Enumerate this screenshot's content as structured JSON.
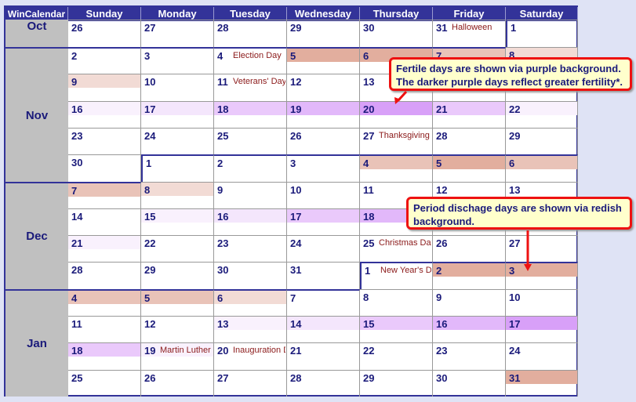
{
  "header": {
    "corner": "WinCalendar",
    "days": [
      "Sunday",
      "Monday",
      "Tuesday",
      "Wednesday",
      "Thursday",
      "Friday",
      "Saturday"
    ]
  },
  "shade_colors": {
    "p3": "#e2ae9e",
    "p2": "#e9c3b8",
    "p1": "#f2dbd5",
    "f4": "#d8a0f8",
    "f3": "#e2b8fa",
    "f2": "#eac9fb",
    "f1": "#f4e6fc",
    "f0": "#f9f1fd"
  },
  "months": [
    {
      "label": "Oct",
      "rows": 1,
      "align": "top"
    },
    {
      "label": "Nov",
      "rows": 5,
      "align": "center"
    },
    {
      "label": "Dec",
      "rows": 4,
      "align": "center"
    },
    {
      "label": "Jan",
      "rows": 4,
      "align": "center"
    }
  ],
  "weeks": [
    [
      {
        "d": "26",
        "m": 0
      },
      {
        "d": "27",
        "m": 0
      },
      {
        "d": "28",
        "m": 0
      },
      {
        "d": "29",
        "m": 0
      },
      {
        "d": "30",
        "m": 0
      },
      {
        "d": "31",
        "m": 0,
        "h": "Halloween"
      },
      {
        "d": "1",
        "m": 1
      }
    ],
    [
      {
        "d": "2",
        "m": 1
      },
      {
        "d": "3",
        "m": 1
      },
      {
        "d": "4",
        "m": 1,
        "h": "Election Day"
      },
      {
        "d": "5",
        "m": 1,
        "s": "p3"
      },
      {
        "d": "6",
        "m": 1,
        "s": "p3"
      },
      {
        "d": "7",
        "m": 1,
        "s": "p2"
      },
      {
        "d": "8",
        "m": 1,
        "s": "p1"
      }
    ],
    [
      {
        "d": "9",
        "m": 1,
        "s": "p1"
      },
      {
        "d": "10",
        "m": 1
      },
      {
        "d": "11",
        "m": 1,
        "h": "Veterans' Day"
      },
      {
        "d": "12",
        "m": 1
      },
      {
        "d": "13",
        "m": 1
      },
      {
        "d": "14",
        "m": 1
      },
      {
        "d": "15",
        "m": 1
      }
    ],
    [
      {
        "d": "16",
        "m": 1,
        "s": "f0"
      },
      {
        "d": "17",
        "m": 1,
        "s": "f1"
      },
      {
        "d": "18",
        "m": 1,
        "s": "f2"
      },
      {
        "d": "19",
        "m": 1,
        "s": "f3"
      },
      {
        "d": "20",
        "m": 1,
        "s": "f4"
      },
      {
        "d": "21",
        "m": 1,
        "s": "f2"
      },
      {
        "d": "22",
        "m": 1,
        "s": "f0"
      }
    ],
    [
      {
        "d": "23",
        "m": 1
      },
      {
        "d": "24",
        "m": 1
      },
      {
        "d": "25",
        "m": 1
      },
      {
        "d": "26",
        "m": 1
      },
      {
        "d": "27",
        "m": 1,
        "h": "Thanksgiving Day"
      },
      {
        "d": "28",
        "m": 1
      },
      {
        "d": "29",
        "m": 1
      }
    ],
    [
      {
        "d": "30",
        "m": 1
      },
      {
        "d": "1",
        "m": 2
      },
      {
        "d": "2",
        "m": 2
      },
      {
        "d": "3",
        "m": 2
      },
      {
        "d": "4",
        "m": 2,
        "s": "p2"
      },
      {
        "d": "5",
        "m": 2,
        "s": "p3"
      },
      {
        "d": "6",
        "m": 2,
        "s": "p2"
      }
    ],
    [
      {
        "d": "7",
        "m": 2,
        "s": "p2"
      },
      {
        "d": "8",
        "m": 2,
        "s": "p1"
      },
      {
        "d": "9",
        "m": 2
      },
      {
        "d": "10",
        "m": 2
      },
      {
        "d": "11",
        "m": 2
      },
      {
        "d": "12",
        "m": 2
      },
      {
        "d": "13",
        "m": 2
      }
    ],
    [
      {
        "d": "14",
        "m": 2
      },
      {
        "d": "15",
        "m": 2,
        "s": "f0"
      },
      {
        "d": "16",
        "m": 2,
        "s": "f1"
      },
      {
        "d": "17",
        "m": 2,
        "s": "f2"
      },
      {
        "d": "18",
        "m": 2,
        "s": "f3"
      },
      {
        "d": "19",
        "m": 2,
        "s": "f4"
      },
      {
        "d": "20",
        "m": 2,
        "s": "f2"
      }
    ],
    [
      {
        "d": "21",
        "m": 2,
        "s": "f0"
      },
      {
        "d": "22",
        "m": 2
      },
      {
        "d": "23",
        "m": 2
      },
      {
        "d": "24",
        "m": 2
      },
      {
        "d": "25",
        "m": 2,
        "h": "Christmas Day"
      },
      {
        "d": "26",
        "m": 2
      },
      {
        "d": "27",
        "m": 2
      }
    ],
    [
      {
        "d": "28",
        "m": 2
      },
      {
        "d": "29",
        "m": 2
      },
      {
        "d": "30",
        "m": 2
      },
      {
        "d": "31",
        "m": 2
      },
      {
        "d": "1",
        "m": 3,
        "h": "New Year's Day"
      },
      {
        "d": "2",
        "m": 3,
        "s": "p3"
      },
      {
        "d": "3",
        "m": 3,
        "s": "p3"
      }
    ],
    [
      {
        "d": "4",
        "m": 3,
        "s": "p2"
      },
      {
        "d": "5",
        "m": 3,
        "s": "p2"
      },
      {
        "d": "6",
        "m": 3,
        "s": "p1"
      },
      {
        "d": "7",
        "m": 3
      },
      {
        "d": "8",
        "m": 3
      },
      {
        "d": "9",
        "m": 3
      },
      {
        "d": "10",
        "m": 3
      }
    ],
    [
      {
        "d": "11",
        "m": 3
      },
      {
        "d": "12",
        "m": 3
      },
      {
        "d": "13",
        "m": 3,
        "s": "f0"
      },
      {
        "d": "14",
        "m": 3,
        "s": "f1"
      },
      {
        "d": "15",
        "m": 3,
        "s": "f2"
      },
      {
        "d": "16",
        "m": 3,
        "s": "f3"
      },
      {
        "d": "17",
        "m": 3,
        "s": "f4"
      }
    ],
    [
      {
        "d": "18",
        "m": 3,
        "s": "f2"
      },
      {
        "d": "19",
        "m": 3,
        "s": "f0",
        "h": "Martin Luther King Day"
      },
      {
        "d": "20",
        "m": 3,
        "h": "Inauguration Day"
      },
      {
        "d": "21",
        "m": 3
      },
      {
        "d": "22",
        "m": 3
      },
      {
        "d": "23",
        "m": 3
      },
      {
        "d": "24",
        "m": 3
      }
    ],
    [
      {
        "d": "25",
        "m": 3
      },
      {
        "d": "26",
        "m": 3
      },
      {
        "d": "27",
        "m": 3
      },
      {
        "d": "28",
        "m": 3
      },
      {
        "d": "29",
        "m": 3
      },
      {
        "d": "30",
        "m": 3
      },
      {
        "d": "31",
        "m": 3,
        "s": "p3"
      }
    ]
  ],
  "callouts": {
    "fertile": "Fertile days are shown via purple background. The darker purple days reflect greater fertility*.",
    "period": "Period dischage days are shown via redish background."
  }
}
